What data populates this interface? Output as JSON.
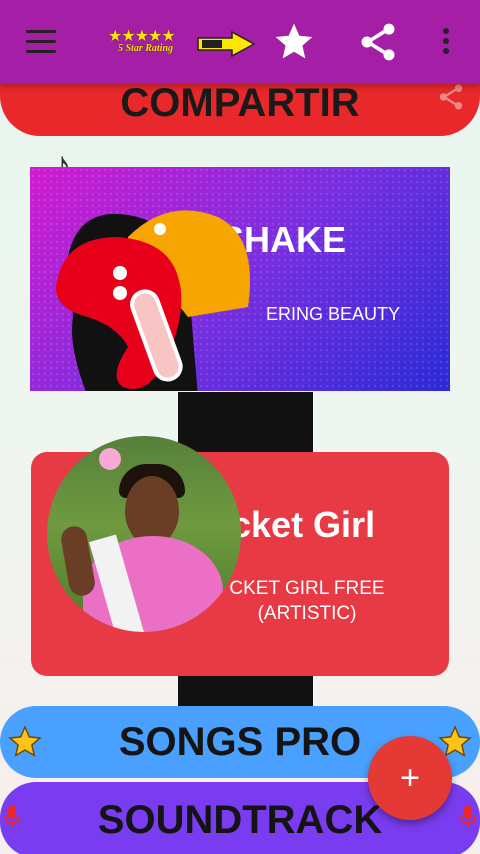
{
  "appbar": {
    "rating_caption": "5 Star Rating",
    "rating_stars": "★★★★★",
    "menu_icon": "menu-icon",
    "star_icon": "star-icon",
    "share_icon": "share-icon",
    "more_icon": "more-vert-icon"
  },
  "compartir": {
    "label": "COMPARTIR"
  },
  "cards": [
    {
      "title": "SHAKE",
      "subtitle": "ERING BEAUTY"
    },
    {
      "title": "cket Girl",
      "subtitle": "CKET GIRL FREE\n(ARTISTIC)"
    }
  ],
  "buttons": {
    "songs_pro": "SONGS PRO",
    "soundtrack": "SOUNDTRACK",
    "fab": "+"
  },
  "colors": {
    "appbar": "#a51ea6",
    "compartir": "#e8282b",
    "songs_pro": "#4aa0ff",
    "soundtrack": "#7a3cf0",
    "fab": "#e53935"
  }
}
